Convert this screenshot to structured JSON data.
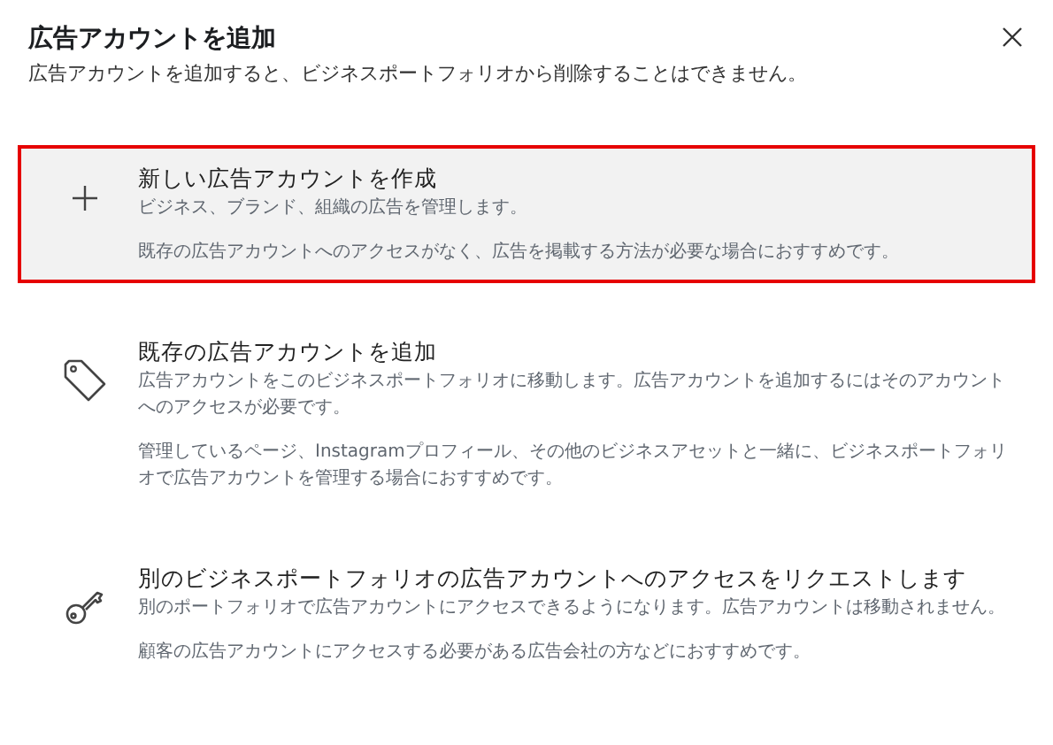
{
  "dialog": {
    "title": "広告アカウントを追加",
    "subtitle": "広告アカウントを追加すると、ビジネスポートフォリオから削除することはできません。"
  },
  "options": [
    {
      "kind": "plus",
      "selected": true,
      "title": "新しい広告アカウントを作成",
      "description": "ビジネス、ブランド、組織の広告を管理します。",
      "note": "既存の広告アカウントへのアクセスがなく、広告を掲載する方法が必要な場合におすすめです。"
    },
    {
      "kind": "tag",
      "selected": false,
      "title": "既存の広告アカウントを追加",
      "description": "広告アカウントをこのビジネスポートフォリオに移動します。広告アカウントを追加するにはそのアカウントへのアクセスが必要です。",
      "note": "管理しているページ、Instagramプロフィール、その他のビジネスアセットと一緒に、ビジネスポートフォリオで広告アカウントを管理する場合におすすめです。"
    },
    {
      "kind": "key",
      "selected": false,
      "title": "別のビジネスポートフォリオの広告アカウントへのアクセスをリクエストします",
      "description": "別のポートフォリオで広告アカウントにアクセスできるようになります。広告アカウントは移動されません。",
      "note": "顧客の広告アカウントにアクセスする必要がある広告会社の方などにおすすめです。"
    }
  ]
}
